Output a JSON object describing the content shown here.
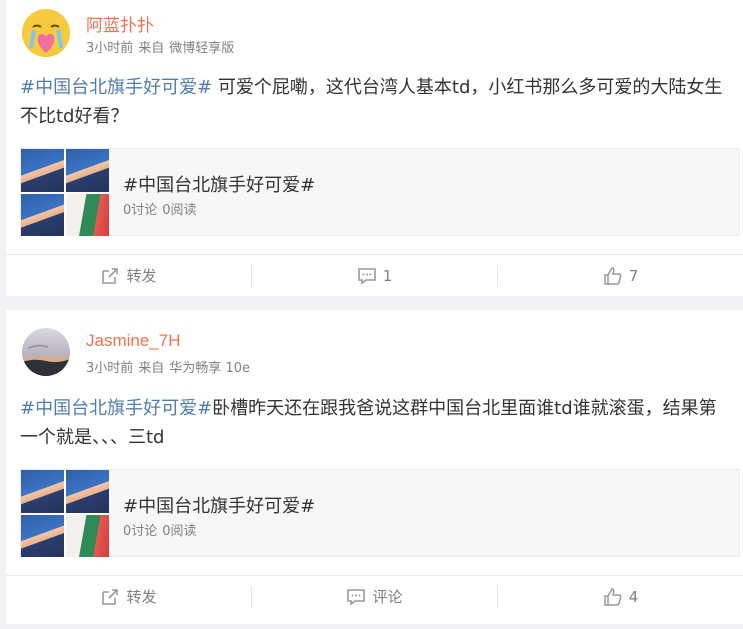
{
  "posts": [
    {
      "username": "阿蓝扑扑",
      "time": "3小时前",
      "source_prefix": "来自",
      "source": "微博轻享版",
      "hashtag": "#中国台北旗手好可爱#",
      "text": " 可爱个屁嘞，这代台湾人基本td，小红书那么多可爱的大陆女生不比td好看？",
      "topic": {
        "title": "#中国台北旗手好可爱#",
        "discussions": "0讨论",
        "reads": "0阅读"
      },
      "actions": {
        "repost": "转发",
        "comment": "1",
        "like": "7"
      }
    },
    {
      "username": "Jasmine_7H",
      "time": "3小时前",
      "source_prefix": "来自",
      "source": "华为畅享 10e",
      "hashtag": "#中国台北旗手好可爱#",
      "text": "卧槽昨天还在跟我爸说这群中国台北里面谁td谁就滚蛋，结果第一个就是、、、三td",
      "topic": {
        "title": "#中国台北旗手好可爱#",
        "discussions": "0讨论",
        "reads": "0阅读"
      },
      "actions": {
        "repost": "转发",
        "comment": "评论",
        "like": "4"
      }
    }
  ],
  "icons": {
    "repost": "share-arrow-icon",
    "comment": "speech-bubble-icon",
    "like": "thumbs-up-icon"
  },
  "colors": {
    "username": "#eb7350",
    "hashtag": "#507daf",
    "meta": "#808080",
    "background": "#f2f2f5"
  }
}
